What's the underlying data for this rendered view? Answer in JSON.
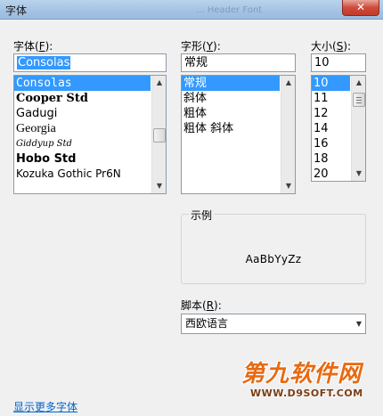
{
  "window": {
    "title": "字体",
    "blurred_title": "... Header Font",
    "close_label": "✕"
  },
  "font": {
    "label": "字体(",
    "hotkey": "F",
    "label_end": "):",
    "value": "Consolas",
    "items": [
      "Consolas",
      "Cooper Std",
      "Gadugi",
      "Georgia",
      "Giddyup Std",
      "Hobo Std",
      "Kozuka Gothic Pr6N"
    ],
    "selected_index": 0
  },
  "style": {
    "label": "字形(",
    "hotkey": "Y",
    "label_end": "):",
    "value": "常规",
    "items": [
      "常规",
      "斜体",
      "粗体",
      "粗体 斜体"
    ],
    "selected_index": 0
  },
  "size": {
    "label": "大小(",
    "hotkey": "S",
    "label_end": "):",
    "value": "10",
    "items": [
      "10",
      "11",
      "12",
      "14",
      "16",
      "18",
      "20"
    ],
    "selected_index": 0
  },
  "sample": {
    "title": "示例",
    "text": "AaBbYyZz"
  },
  "script": {
    "label": "脚本(",
    "hotkey": "R",
    "label_end": "):",
    "value": "西欧语言"
  },
  "more_fonts_link": "显示更多字体",
  "watermark": {
    "cn": "第九软件网",
    "en": "WWW.D9SOFT.COM"
  },
  "icons": {
    "scroll_up": "▲",
    "scroll_down": "▼",
    "dropdown": "▼"
  }
}
